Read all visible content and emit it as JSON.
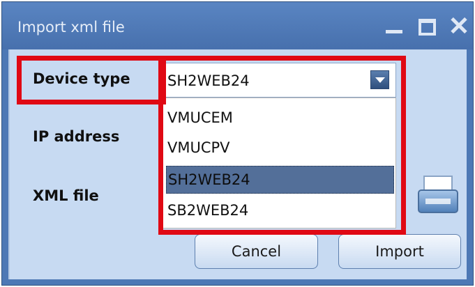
{
  "window": {
    "title": "Import xml file",
    "controls": {
      "minimize_icon": "minimize-icon",
      "maximize_icon": "maximize-icon",
      "close_icon": "close-icon"
    }
  },
  "form": {
    "device_type_label": "Device type",
    "ip_address_label": "IP address",
    "xml_file_label": "XML file",
    "device_type_value": "SH2WEB24",
    "device_type_options": [
      "VMUCEM",
      "VMUCPV",
      "SH2WEB24",
      "SB2WEB24"
    ],
    "selected_option": "SH2WEB24"
  },
  "buttons": {
    "cancel": "Cancel",
    "import": "Import"
  },
  "icons": {
    "dropdown": "chevron-down-icon",
    "browse": "printer-icon"
  },
  "colors": {
    "highlight": "#e00914",
    "title_bar": "#4d78b5",
    "client_bg": "#c7daf2",
    "selected_item": "#536f99"
  }
}
